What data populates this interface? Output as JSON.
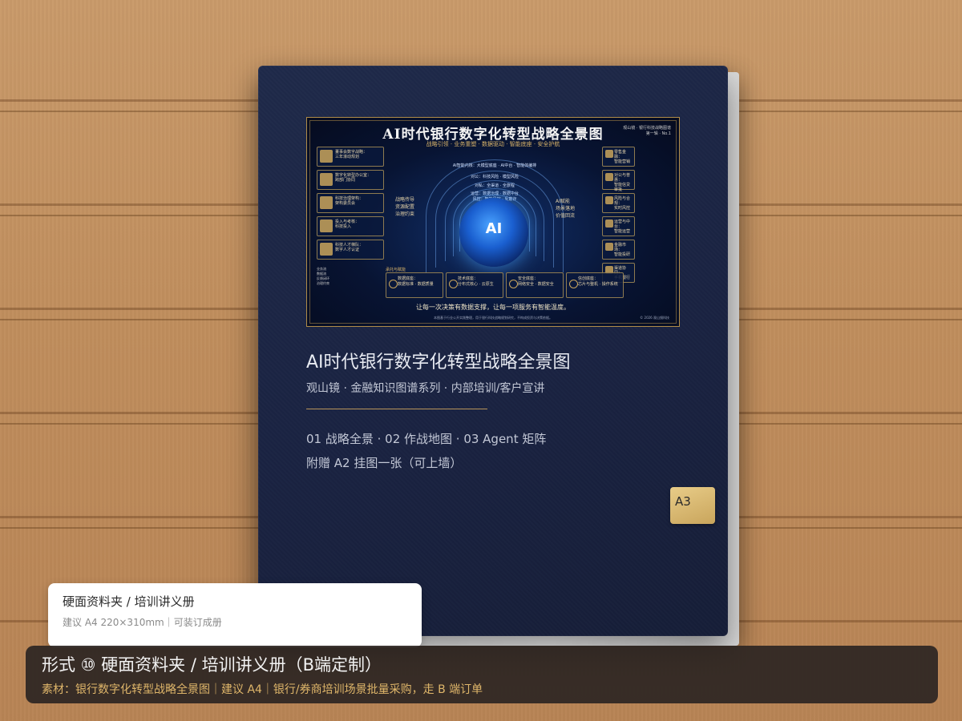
{
  "poster": {
    "title": "AI时代银行数字化转型战略全景图",
    "tagline": "战略引领 · 业务重塑 · 数据驱动 · 智能底座 · 安全护航",
    "corner": "观山镜 · 银行科技战略图谱\n第一辑 · No.1",
    "left_boxes": [
      {
        "title": "董事会数字战略：",
        "desc": "三年滚动规划"
      },
      {
        "title": "数字化转型办公室：",
        "desc": "跨部门协同"
      },
      {
        "title": "科技治理架构：",
        "desc": "架构委员会"
      },
      {
        "title": "投入与考核：",
        "desc": "科技投入"
      },
      {
        "title": "科技人才梯队：",
        "desc": "数字人才认证"
      }
    ],
    "mid_left": "战略传导\n资源配置\n治理约束",
    "mid_right": "AI赋能\n场景落地\n价值回流",
    "arc_labels": [
      "AI智能内核：大模型底座 · AI中台 · 智能体编排",
      "对公：科技风险 · 模型风险",
      "对私：全渠道 · 全旅程",
      "运营：数据治理 · 数据中台",
      "风控：智能风控 · 反欺诈"
    ],
    "globe": "AI",
    "right_boxes": [
      {
        "title": "零售金融：",
        "desc": "智能营销"
      },
      {
        "title": "对公与普惠：",
        "desc": "智能信贷审批"
      },
      {
        "title": "风险与合规：",
        "desc": "实时风控"
      },
      {
        "title": "运营与中台：",
        "desc": "智能运营"
      },
      {
        "title": "金融市场：",
        "desc": "智能投研"
      },
      {
        "title": "渠道协同：",
        "desc": "手机银行"
      }
    ],
    "bottom_boxes": [
      {
        "title": "数据底座：",
        "desc": "数据标准 · 数据质量"
      },
      {
        "title": "技术底座：",
        "desc": "分布式核心 · 云原生"
      },
      {
        "title": "安全底座：",
        "desc": "网络安全 · 数据安全"
      },
      {
        "title": "信创底座：",
        "desc": "芯片与整机 · 操作系统"
      }
    ],
    "support_label": "承托与赋能",
    "legend": [
      "业务流",
      "数据流",
      "反馈闭环",
      "治理约束"
    ],
    "slogan": "让每一次决策有数据支撑，让每一项服务有智能温度。",
    "footnote": "本图基于行业公开实践整理，用于银行科技战略规划研究，不构成投资与决策依据。",
    "copyright": "© 2026 观山镜科技"
  },
  "folder": {
    "title": "AI时代银行数字化转型战略全景图",
    "subtitle": "观山镜 · 金融知识图谱系列 · 内部培训/客户宣讲",
    "chapters": "01 战略全景 · 02 作战地图 · 03 Agent 矩阵",
    "gift": "附赠 A2 挂图一张（可上墙）",
    "size_tag": "A3"
  },
  "note": {
    "title": "硬面资料夹 / 培训讲义册",
    "detail": "建议 A4 220×310mm｜可装订成册"
  },
  "caption": {
    "title": "形式 ⑩ 硬面资料夹 / 培训讲义册（B端定制）",
    "detail": "素材：银行数字化转型战略全景图｜建议 A4｜银行/券商培训场景批量采购，走 B 端订单"
  },
  "colors": {
    "folder": "#1c2545",
    "gold": "#c9a55c",
    "caption_bg": "#2d2622",
    "caption_accent": "#dfb66a"
  }
}
